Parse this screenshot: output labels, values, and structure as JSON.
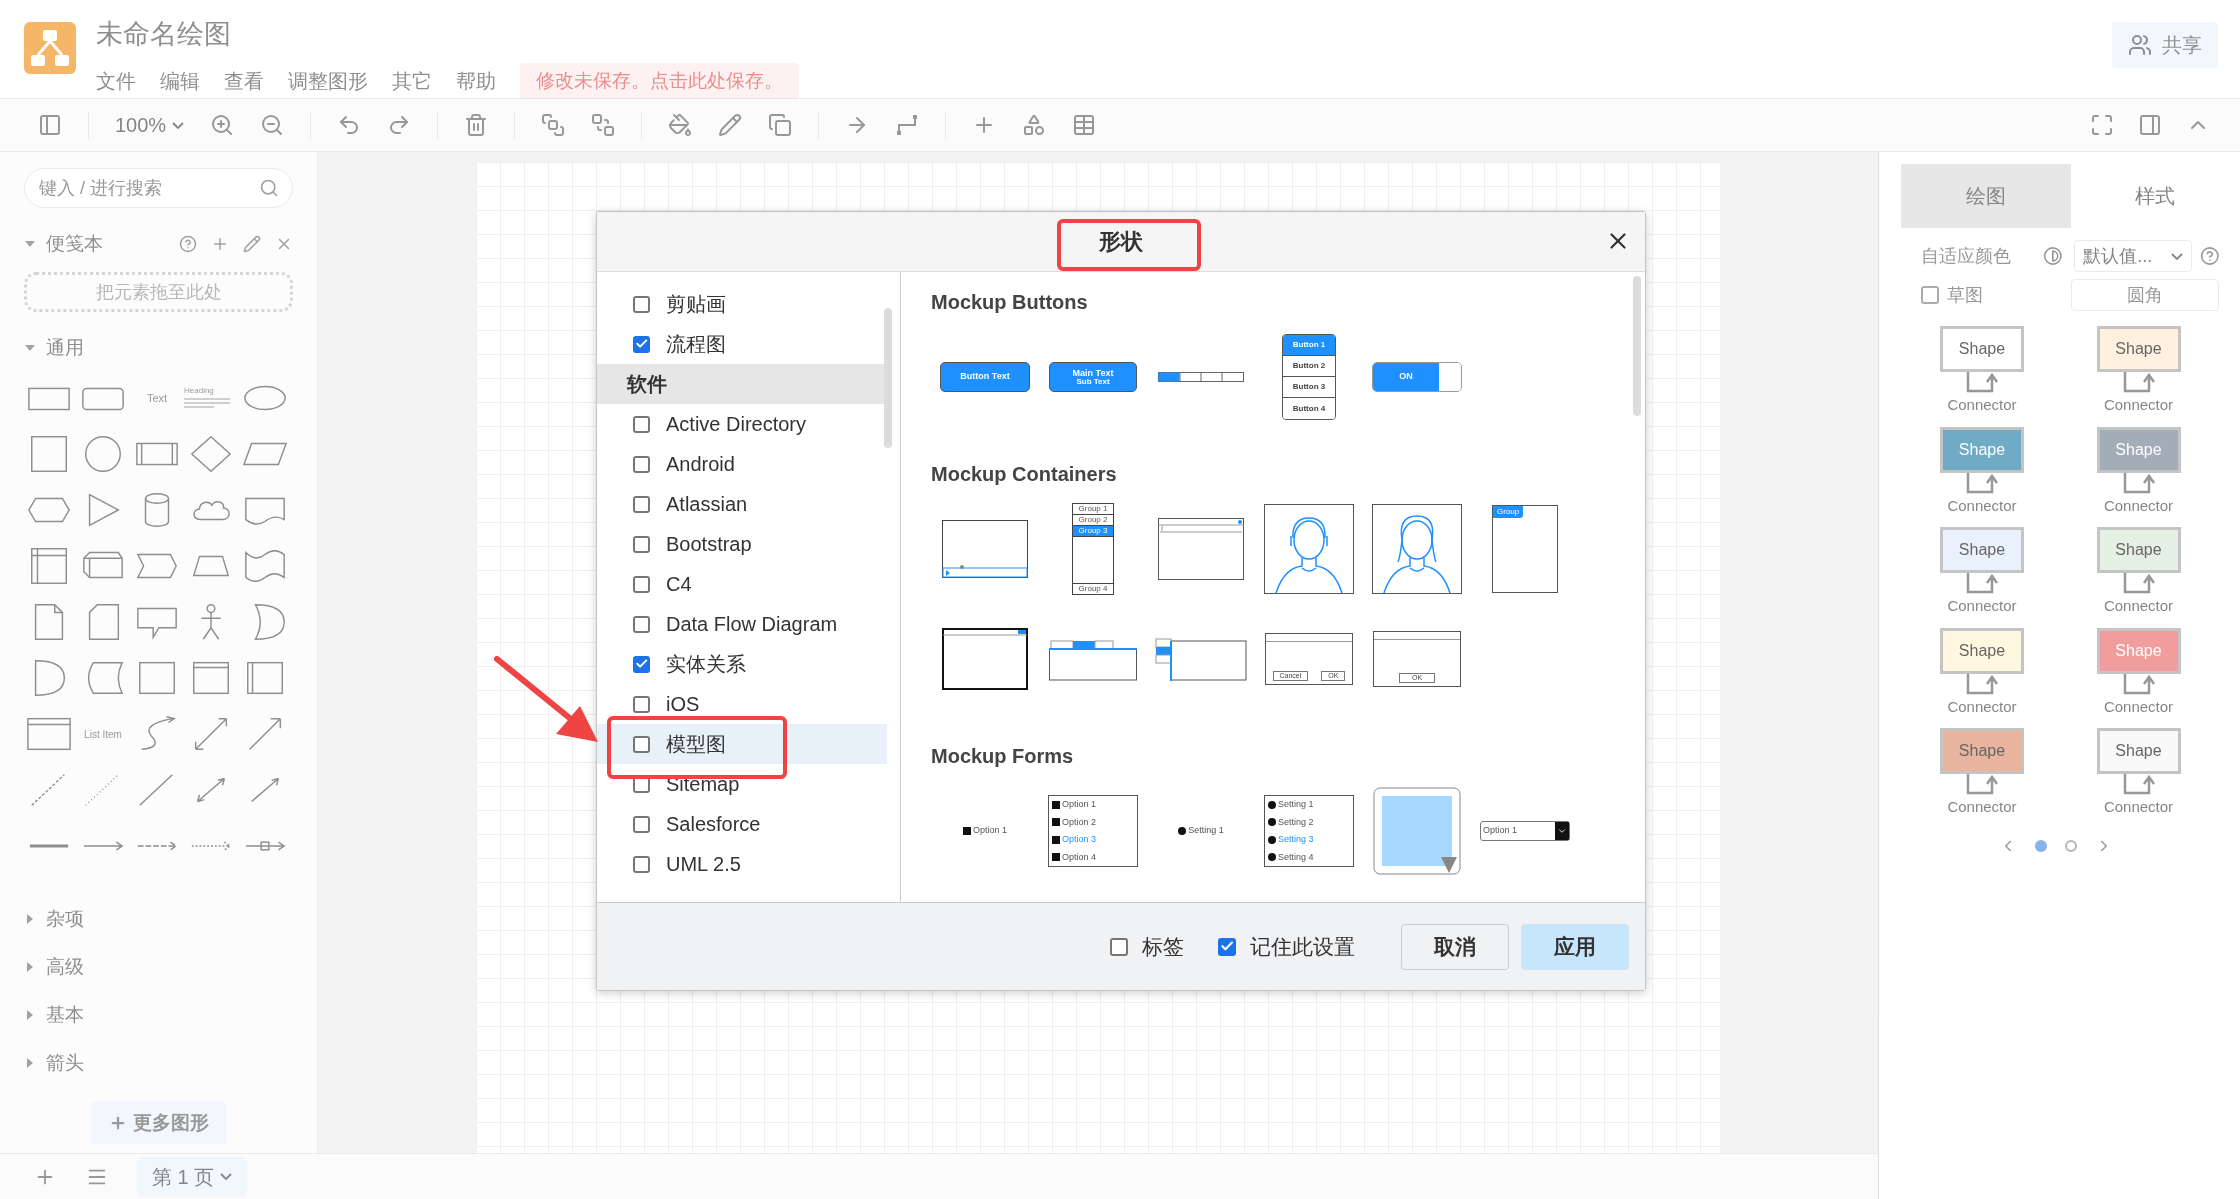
{
  "app": {
    "title": "未命名绘图",
    "menu": [
      "文件",
      "编辑",
      "查看",
      "调整图形",
      "其它",
      "帮助"
    ],
    "unsaved_notice": "修改未保存。点击此处保存。",
    "share": "共享"
  },
  "toolbar": {
    "zoom": "100%"
  },
  "sidebar": {
    "search": {
      "placeholder": "键入 / 进行搜索"
    },
    "scratchpad": {
      "title": "便笺本",
      "expanded": true,
      "drop_hint": "把元素拖至此处"
    },
    "general": {
      "title": "通用",
      "expanded": true,
      "texts": {
        "text": "Text",
        "heading": "Heading",
        "list_item": "List Item"
      }
    },
    "sections": [
      {
        "title": "杂项",
        "expanded": false
      },
      {
        "title": "高级",
        "expanded": false
      },
      {
        "title": "基本",
        "expanded": false
      },
      {
        "title": "箭头",
        "expanded": false
      }
    ],
    "more_shapes": "更多图形"
  },
  "pages": {
    "current": "第 1 页"
  },
  "format_panel": {
    "tabs": [
      {
        "label": "绘图",
        "selected": false
      },
      {
        "label": "样式",
        "selected": true
      }
    ],
    "adaptive_colors": "自适应颜色",
    "theme_select": "默认值...",
    "sketch": {
      "label": "草图",
      "checked": false
    },
    "rounded": "圆角",
    "styles": [
      {
        "shape": "Shape",
        "connector": "Connector",
        "color": "#ffffff"
      },
      {
        "shape": "Shape",
        "connector": "Connector",
        "color": "#fff0e0"
      },
      {
        "shape": "Shape",
        "connector": "Connector",
        "color": "#70abc5"
      },
      {
        "shape": "Shape",
        "connector": "Connector",
        "color": "#a2adb7"
      },
      {
        "shape": "Shape",
        "connector": "Connector",
        "color": "#e9f1fd"
      },
      {
        "shape": "Shape",
        "connector": "Connector",
        "color": "#e6f1e5"
      },
      {
        "shape": "Shape",
        "connector": "Connector",
        "color": "#fff7e0"
      },
      {
        "shape": "Shape",
        "connector": "Connector",
        "color": "#f19d9d"
      },
      {
        "shape": "Shape",
        "connector": "Connector",
        "color": "#e8b49d"
      },
      {
        "shape": "Shape",
        "connector": "Connector",
        "color": "#f9f9f9"
      }
    ],
    "style_pages": [
      {
        "selected": true
      },
      {
        "selected": false
      }
    ]
  },
  "dialog": {
    "title": "形状",
    "list": [
      {
        "kind": "item",
        "label": "剪贴画",
        "checked": false,
        "selected": false
      },
      {
        "kind": "item",
        "label": "流程图",
        "checked": true,
        "selected": false
      },
      {
        "kind": "header",
        "label": "软件"
      },
      {
        "kind": "item",
        "label": "Active Directory",
        "checked": false,
        "selected": false
      },
      {
        "kind": "item",
        "label": "Android",
        "checked": false,
        "selected": false
      },
      {
        "kind": "item",
        "label": "Atlassian",
        "checked": false,
        "selected": false
      },
      {
        "kind": "item",
        "label": "Bootstrap",
        "checked": false,
        "selected": false
      },
      {
        "kind": "item",
        "label": "C4",
        "checked": false,
        "selected": false
      },
      {
        "kind": "item",
        "label": "Data Flow Diagram",
        "checked": false,
        "selected": false
      },
      {
        "kind": "item",
        "label": "实体关系",
        "checked": true,
        "selected": false
      },
      {
        "kind": "item",
        "label": "iOS",
        "checked": false,
        "selected": false
      },
      {
        "kind": "item",
        "label": "模型图",
        "checked": false,
        "selected": true
      },
      {
        "kind": "item",
        "label": "Sitemap",
        "checked": false,
        "selected": false
      },
      {
        "kind": "item",
        "label": "Salesforce",
        "checked": false,
        "selected": false
      },
      {
        "kind": "item",
        "label": "UML 2.5",
        "checked": false,
        "selected": false
      }
    ],
    "sections": [
      {
        "title": "Mockup Buttons",
        "rows": [
          [
            {
              "kind": "button",
              "texts": [
                "Button Text"
              ]
            },
            {
              "kind": "button2",
              "texts": [
                "Main Text",
                "Sub Text"
              ]
            },
            {
              "kind": "segmented"
            },
            {
              "kind": "button_stack",
              "options": [
                {
                  "label": "Button 1",
                  "selected": true
                },
                {
                  "label": "Button 2",
                  "selected": false
                },
                {
                  "label": "Button 3",
                  "selected": false
                },
                {
                  "label": "Button 4",
                  "selected": false
                }
              ]
            },
            {
              "kind": "switch",
              "texts": [
                "ON"
              ],
              "on": true
            }
          ]
        ]
      },
      {
        "title": "Mockup Containers",
        "rows": [
          [
            {
              "kind": "video"
            },
            {
              "kind": "accordion",
              "options": [
                {
                  "label": "Group 1",
                  "selected": false
                },
                {
                  "label": "Group 2",
                  "selected": false
                },
                {
                  "label": "Group 3",
                  "selected": true
                },
                {
                  "label": "Group 4",
                  "selected": false
                }
              ]
            },
            {
              "kind": "browser"
            },
            {
              "kind": "avatar"
            },
            {
              "kind": "avatar_long_hair"
            },
            {
              "kind": "group",
              "texts": [
                "Group"
              ]
            }
          ],
          [
            {
              "kind": "window"
            },
            {
              "kind": "tabs_horizontal"
            },
            {
              "kind": "tabs_vertical"
            },
            {
              "kind": "dialog",
              "texts": [
                "Cancel",
                "OK"
              ]
            },
            {
              "kind": "message_box",
              "texts": [
                "OK"
              ]
            }
          ]
        ]
      },
      {
        "title": "Mockup Forms",
        "rows": [
          [
            {
              "kind": "checkbox",
              "texts": [
                "Option 1"
              ]
            },
            {
              "kind": "checkbox_list",
              "options": [
                {
                  "label": "Option 1",
                  "selected": false
                },
                {
                  "label": "Option 2",
                  "selected": false
                },
                {
                  "label": "Option 3",
                  "selected": true
                },
                {
                  "label": "Option 4",
                  "selected": false
                }
              ]
            },
            {
              "kind": "radio",
              "texts": [
                "Setting 1"
              ]
            },
            {
              "kind": "radio_group",
              "options": [
                {
                  "label": "Setting 1",
                  "selected": false
                },
                {
                  "label": "Setting 2",
                  "selected": false
                },
                {
                  "label": "Setting 3",
                  "selected": true
                },
                {
                  "label": "Setting 4",
                  "selected": false
                }
              ]
            },
            {
              "kind": "color_picker"
            },
            {
              "kind": "combobox",
              "texts": [
                "Option 1"
              ]
            }
          ]
        ]
      }
    ],
    "options": [
      {
        "label": "标签",
        "checked": false
      },
      {
        "label": "记住此设置",
        "checked": true
      }
    ],
    "buttons": [
      {
        "kind": "cancel",
        "label": "取消"
      },
      {
        "kind": "apply",
        "label": "应用"
      }
    ]
  }
}
